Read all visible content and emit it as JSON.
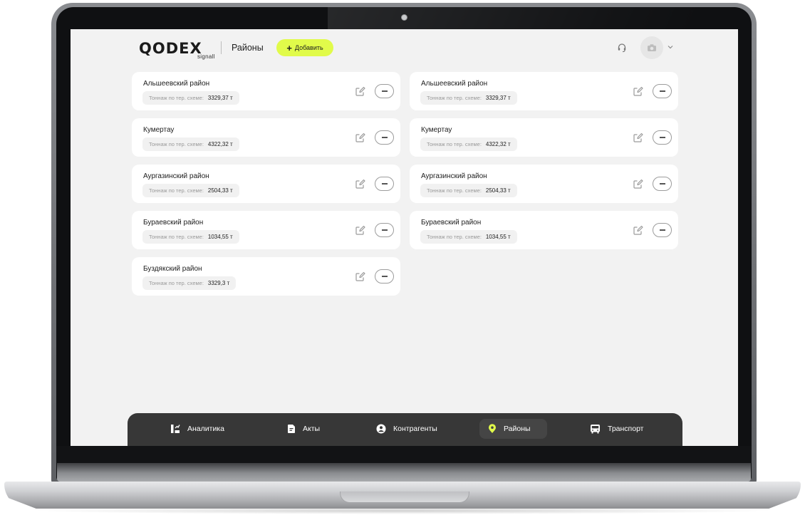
{
  "header": {
    "logo": "QODEX",
    "logo_sub": "signall",
    "page_title": "Районы",
    "add_button": "Добавить"
  },
  "districts": [
    {
      "name": "Альшеевский район",
      "tonnage_label": "Тоннаж по тер. схеме:",
      "tonnage": "3329,37 т"
    },
    {
      "name": "Альшеевский район",
      "tonnage_label": "Тоннаж по тер. схеме:",
      "tonnage": "3329,37 т"
    },
    {
      "name": "Кумертау",
      "tonnage_label": "Тоннаж по тер. схеме:",
      "tonnage": "4322,32 т"
    },
    {
      "name": "Кумертау",
      "tonnage_label": "Тоннаж по тер. схеме:",
      "tonnage": "4322,32 т"
    },
    {
      "name": "Аургазинский район",
      "tonnage_label": "Тоннаж по тер. схеме:",
      "tonnage": "2504,33 т"
    },
    {
      "name": "Аургазинский район",
      "tonnage_label": "Тоннаж по тер. схеме:",
      "tonnage": "2504,33 т"
    },
    {
      "name": "Бураевский район",
      "tonnage_label": "Тоннаж по тер. схеме:",
      "tonnage": "1034,55 т"
    },
    {
      "name": "Бураевский район",
      "tonnage_label": "Тоннаж по тер. схеме:",
      "tonnage": "1034,55 т"
    },
    {
      "name": "Буздякский район",
      "tonnage_label": "Тоннаж по тер. схеме:",
      "tonnage": "3329,3 т"
    }
  ],
  "nav": [
    {
      "label": "Аналитика",
      "icon": "analytics-icon"
    },
    {
      "label": "Акты",
      "icon": "document-icon"
    },
    {
      "label": "Контрагенты",
      "icon": "user-icon"
    },
    {
      "label": "Районы",
      "icon": "location-pin-icon",
      "active": true
    },
    {
      "label": "Транспорт",
      "icon": "bus-icon"
    }
  ],
  "colors": {
    "accent": "#e1fb4a",
    "nav_bg": "#373737",
    "screen_bg": "#f2f2f2"
  }
}
